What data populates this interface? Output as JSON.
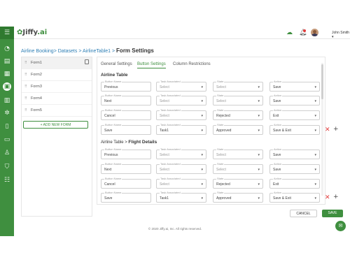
{
  "brand": {
    "logo_text": "Jiffy",
    "logo_suffix": ".ai"
  },
  "header": {
    "user_name": "John Smith",
    "user_caret": "▾"
  },
  "sidebar": {
    "icons": [
      "menu-icon",
      "dashboard-icon",
      "apps-icon",
      "documents-icon",
      "table-icon",
      "grid-icon",
      "settings-cog-icon",
      "file-icon",
      "form-icon",
      "list-icon",
      "user-icon",
      "shield-icon",
      "sliders-icon"
    ]
  },
  "breadcrumb": {
    "part1": "Airline Booking",
    "sep1": "> ",
    "part2": "Datasets",
    "sep2": " > ",
    "part3": "AirlineTable1",
    "sep3": " > ",
    "current": "Form Settings"
  },
  "forms": {
    "items": [
      "Form1",
      "Form2",
      "Form3",
      "Form4",
      "Form5"
    ],
    "add_label": "+ ADD NEW FORM"
  },
  "tabs": [
    "General Settings",
    "Button Settings",
    "Column Restrictions"
  ],
  "section1": {
    "title": "Airline Table"
  },
  "section2": {
    "prefix": "Airline Table > ",
    "title": "Flight Details"
  },
  "field_labels": {
    "button_name": "Button Name",
    "task": "Task Associated",
    "state": "State",
    "action": "Action"
  },
  "select_placeholder": "Select",
  "rows1": [
    {
      "name": "Previous",
      "task": "Select",
      "state": "Select",
      "action": "Save"
    },
    {
      "name": "Next",
      "task": "Select",
      "state": "Select",
      "action": "Save"
    },
    {
      "name": "Cancel",
      "task": "Select",
      "state": "Rejected",
      "action": "Exit"
    },
    {
      "name": "Save",
      "task": "Task1",
      "state": "Approved",
      "action": "Save & Exit"
    }
  ],
  "rows2": [
    {
      "name": "Previous",
      "task": "Select",
      "state": "Select",
      "action": "Save"
    },
    {
      "name": "Next",
      "task": "Select",
      "state": "Select",
      "action": "Save"
    },
    {
      "name": "Cancel",
      "task": "Select",
      "state": "Rejected",
      "action": "Exit"
    },
    {
      "name": "Save",
      "task": "Task1",
      "state": "Approved",
      "action": "Save & Exit"
    }
  ],
  "buttons": {
    "cancel": "CANCEL",
    "save": "SAVE"
  },
  "footer": {
    "copyright": "© 2020 Jiffy.ai, Inc. All rights reserved."
  },
  "colors": {
    "accent": "#3f8f3f",
    "delete": "#e23b3b",
    "link": "#2f7fb5"
  }
}
